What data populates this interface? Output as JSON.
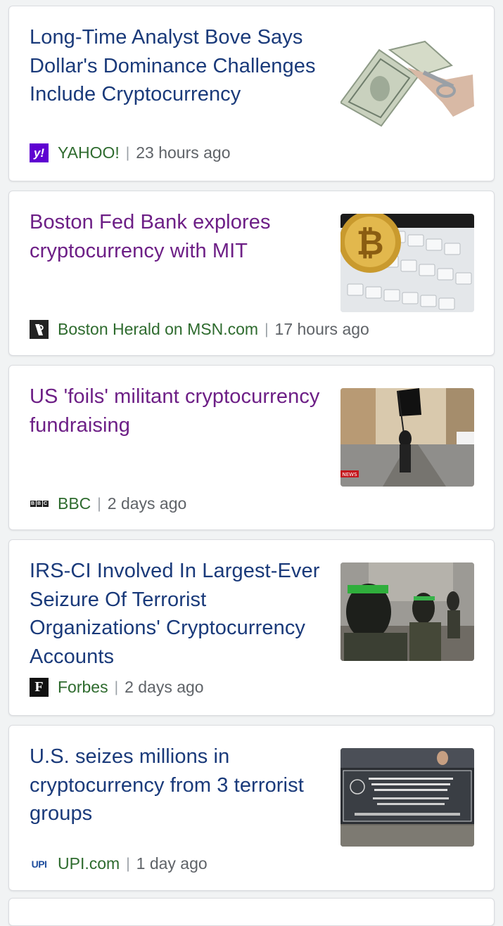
{
  "colors": {
    "title_unvisited": "#1a3a7a",
    "title_visited": "#6d1f86",
    "source_name": "#2e6b2e",
    "time": "#5f6368",
    "card_border": "#dadce0"
  },
  "separator": "|",
  "articles": [
    {
      "title": "Long-Time Analyst Bove Says Dollar's Dominance Challenges Include Cryptocurrency",
      "source": "YAHOO!",
      "logo_icon": "yahoo-logo-icon",
      "logo_text": "y!",
      "time": "23 hours ago",
      "thumbnail": "dollar-bill-scissors-image",
      "visited": false
    },
    {
      "title": "Boston Fed Bank explores cryptocurrency with MIT",
      "source": "Boston Herald on MSN.com",
      "logo_icon": "boston-herald-logo-icon",
      "logo_text": "",
      "time": "17 hours ago",
      "thumbnail": "bitcoin-keyboard-image",
      "visited": true
    },
    {
      "title": "US 'foils' militant cryptocurrency fundraising",
      "source": "BBC",
      "logo_icon": "bbc-logo-icon",
      "logo_text": "BBC",
      "time": "2 days ago",
      "thumbnail": "street-flag-image",
      "thumb_label": "NEWS",
      "visited": true
    },
    {
      "title": "IRS-CI Involved In Largest-Ever Seizure Of Terrorist Organizations' Cryptocurrency Accounts",
      "source": "Forbes",
      "logo_icon": "forbes-logo-icon",
      "logo_text": "F",
      "time": "2 days ago",
      "thumbnail": "masked-fighters-image",
      "visited": false
    },
    {
      "title": "U.S. seizes millions in cryptocurrency from 3 terrorist groups",
      "source": "UPI.com",
      "logo_icon": "upi-logo-icon",
      "logo_text": "UPI",
      "time": "1 day ago",
      "thumbnail": "banner-protest-image",
      "visited": false
    }
  ]
}
